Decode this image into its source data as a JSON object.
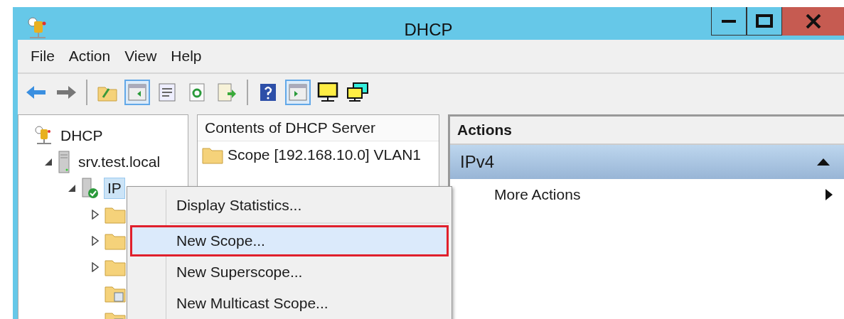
{
  "window": {
    "title": "DHCP"
  },
  "menu_bar": [
    "File",
    "Action",
    "View",
    "Help"
  ],
  "toolbar": [
    {
      "kind": "back",
      "pressed": false
    },
    {
      "kind": "forward",
      "pressed": false
    },
    {
      "kind": "separator"
    },
    {
      "kind": "up",
      "pressed": false
    },
    {
      "kind": "tree-pane",
      "pressed": true
    },
    {
      "kind": "properties",
      "pressed": false
    },
    {
      "kind": "refresh",
      "pressed": false
    },
    {
      "kind": "export",
      "pressed": false
    },
    {
      "kind": "separator"
    },
    {
      "kind": "help",
      "pressed": false
    },
    {
      "kind": "action-pane",
      "pressed": true
    },
    {
      "kind": "monitor",
      "pressed": false
    },
    {
      "kind": "monitors",
      "pressed": false
    }
  ],
  "tree": [
    {
      "label": "DHCP",
      "kind": "dhcp",
      "selected": false,
      "children": [
        {
          "label": "srv.test.local",
          "kind": "server",
          "expanded": true,
          "selected": false,
          "children": [
            {
              "label": "IP",
              "kind": "ipv",
              "expanded": true,
              "selected": true,
              "children": [
                {
                  "kind": "folder",
                  "expanded": false
                },
                {
                  "kind": "folder",
                  "expanded": false
                },
                {
                  "kind": "folder",
                  "expanded": false
                },
                {
                  "kind": "folder-special"
                },
                {
                  "kind": "folder-special"
                }
              ]
            }
          ]
        }
      ]
    }
  ],
  "content_pane": {
    "header": "Contents of DHCP Server",
    "rows": [
      {
        "label": "Scope [192.168.10.0] VLAN1"
      }
    ]
  },
  "actions_pane": {
    "header": "Actions",
    "sections": [
      {
        "title": "IPv4",
        "expanded": true,
        "items": [
          {
            "label": "More Actions",
            "submenu": true
          }
        ]
      }
    ]
  },
  "context_menu": {
    "items": [
      {
        "kind": "item",
        "label": "Display Statistics...",
        "selected": false,
        "outlined": false
      },
      {
        "kind": "separator"
      },
      {
        "kind": "item",
        "label": "New Scope...",
        "selected": true,
        "outlined": true
      },
      {
        "kind": "item",
        "label": "New Superscope...",
        "selected": false,
        "outlined": false
      },
      {
        "kind": "item",
        "label": "New Multicast Scope...",
        "selected": false,
        "outlined": false
      }
    ]
  }
}
